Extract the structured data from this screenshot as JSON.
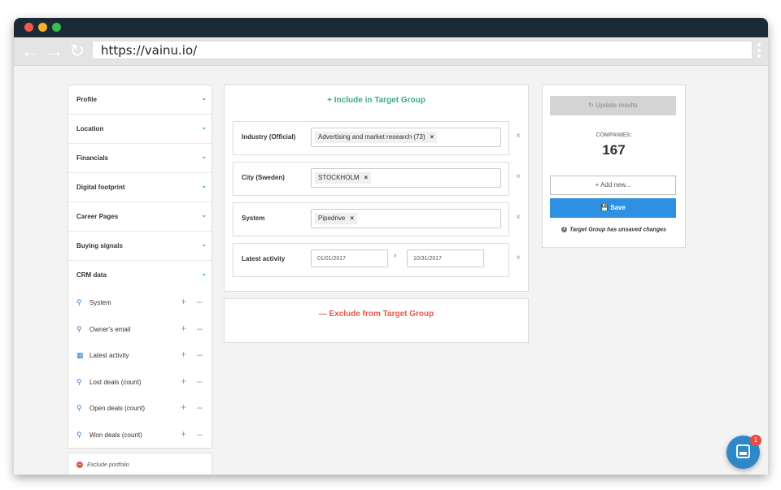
{
  "browser": {
    "url": "https://vainu.io/",
    "back_icon": "arrow-left-icon",
    "forward_icon": "arrow-right-icon",
    "reload_icon": "reload-icon"
  },
  "sidebar": {
    "sections": [
      {
        "label": "Profile"
      },
      {
        "label": "Location"
      },
      {
        "label": "Financials"
      },
      {
        "label": "Digital footprint"
      },
      {
        "label": "Career Pages"
      },
      {
        "label": "Buying signals"
      },
      {
        "label": "CRM data"
      }
    ],
    "crm_items": [
      {
        "label": "System",
        "icon": "search-icon"
      },
      {
        "label": "Owner's email",
        "icon": "search-icon"
      },
      {
        "label": "Latest activity",
        "icon": "calendar-icon"
      },
      {
        "label": "Lost deals (count)",
        "icon": "search-icon"
      },
      {
        "label": "Open deals (count)",
        "icon": "search-icon"
      },
      {
        "label": "Won deals (count)",
        "icon": "search-icon"
      }
    ],
    "exclude_portfolio": "Exclude portfolio"
  },
  "include": {
    "heading": "Include in Target Group",
    "criteria": [
      {
        "label": "Industry (Official)",
        "chip": "Advertising and market research (73)"
      },
      {
        "label": "City (Sweden)",
        "chip": "STOCKHOLM"
      },
      {
        "label": "System",
        "chip": "Pipedrive"
      },
      {
        "label": "Latest activity",
        "date_from": "01/01/2017",
        "date_to": "10/31/2017"
      }
    ]
  },
  "exclude": {
    "heading": "Exclude from Target Group"
  },
  "results": {
    "update_label": "Update results",
    "companies_label": "COMPANIES:",
    "companies_count": "167",
    "add_new_label": "Add new...",
    "save_label": "Save",
    "unsaved_text": "Target Group has unsaved changes"
  },
  "chat": {
    "badge_count": "1"
  },
  "colors": {
    "accent_green": "#3aaa8a",
    "accent_red": "#e35a4a",
    "primary_blue": "#2e90e2",
    "titlebar": "#1c2a36"
  }
}
